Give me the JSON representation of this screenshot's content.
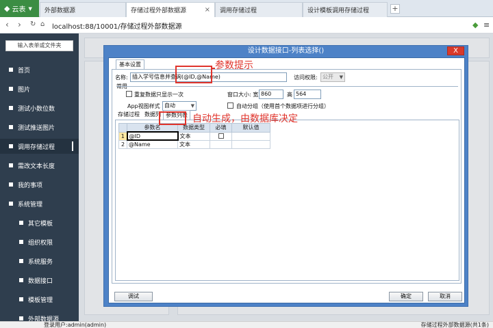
{
  "tabbar": {
    "app_name": "云表",
    "tabs": [
      {
        "label": "外部数据源"
      },
      {
        "label": "存储过程外部数据源",
        "close": "×"
      },
      {
        "label": "调用存储过程"
      },
      {
        "label": "设计模板调用存储过程"
      }
    ],
    "add": "+"
  },
  "address": {
    "url": "localhost:88/10001/存储过程外部数据源"
  },
  "sidebar": {
    "search_placeholder": "输入表单或文件夹",
    "items": [
      {
        "label": "首页"
      },
      {
        "label": "图片"
      },
      {
        "label": "测试小数位数"
      },
      {
        "label": "测试推送图片"
      },
      {
        "label": "调用存储过程",
        "active": true
      },
      {
        "label": "需改文本长度"
      },
      {
        "label": "我的事项"
      },
      {
        "label": "系统管理"
      },
      {
        "label": "其它模板"
      },
      {
        "label": "组织权限"
      },
      {
        "label": "系统服务"
      },
      {
        "label": "数据接口"
      },
      {
        "label": "模板管理"
      },
      {
        "label": "外部数据源"
      }
    ]
  },
  "dialog": {
    "title": "设计数据接口-列表选择()",
    "close": "X",
    "basic_tab": "基本设置",
    "name_label": "名称:",
    "name_value": "插入学号信息并查询(@ID,@Name)",
    "access_label": "访问权限:",
    "access_value": "公开",
    "section_label": "常用",
    "repeat_label": "重复数据只显示一次",
    "window_size_label": "窗口大小: 宽",
    "width_value": "860",
    "height_label": "高",
    "height_value": "564",
    "app_view_label": "App视图样式",
    "app_view_value": "自动",
    "auto_group_label": "自动分组（使用首个数据项进行分组）",
    "inner_tabs": [
      "存储过程",
      "数据列",
      "参数列表"
    ],
    "grid": {
      "headers": [
        "参数名",
        "数据类型",
        "必填",
        "默认值"
      ],
      "rows": [
        {
          "n": "1",
          "name": "@ID",
          "type": "文本"
        },
        {
          "n": "2",
          "name": "@Name",
          "type": "文本"
        }
      ]
    },
    "buttons": {
      "test": "调试",
      "ok": "确定",
      "cancel": "取消"
    }
  },
  "annotations": {
    "param_hint": "参数提示",
    "auto_gen": "自动生成，由数据库决定"
  },
  "status": {
    "left": "登录用户:admin(admin)",
    "right": "存储过程外部数据源(共1条)"
  },
  "colors": {
    "sidebar_bg": "#2f3e4e",
    "dialog_frame": "#4d82c7",
    "annotation_red": "#e0332b",
    "app_green": "#3b8d43"
  }
}
